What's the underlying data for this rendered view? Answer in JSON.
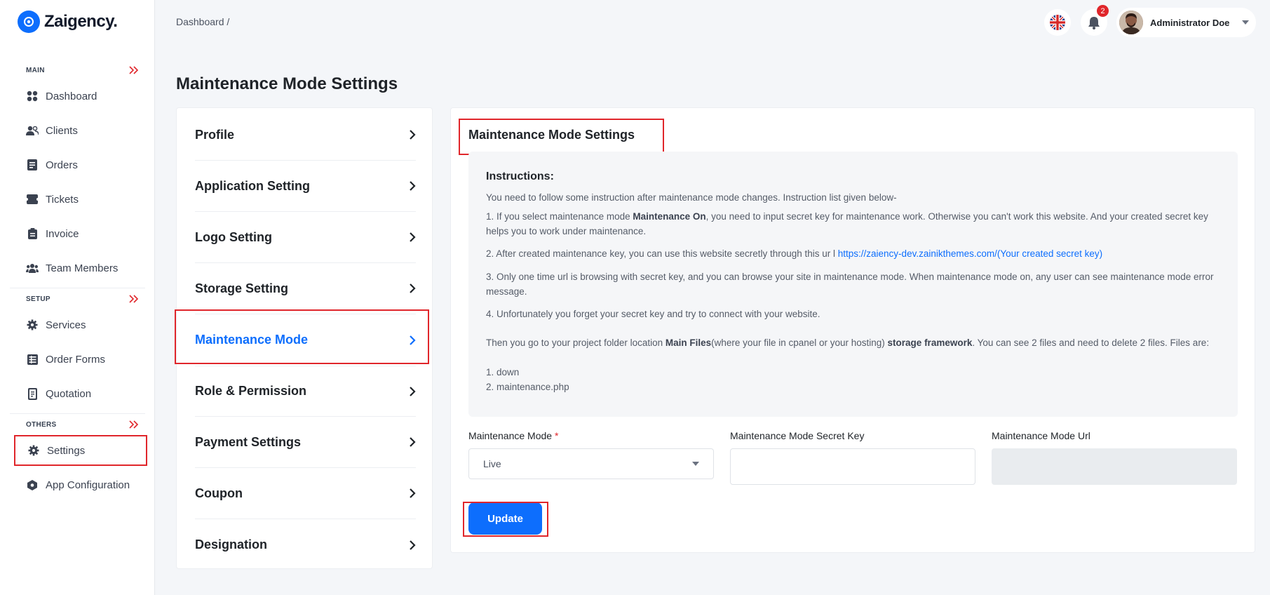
{
  "app": {
    "logo_text": "Zaigency."
  },
  "sidebar": {
    "sections": [
      {
        "label": "MAIN"
      },
      {
        "label": "SETUP"
      },
      {
        "label": "OTHERS"
      }
    ],
    "items": [
      {
        "label": "Dashboard",
        "icon": "grid-icon"
      },
      {
        "label": "Clients",
        "icon": "users-icon"
      },
      {
        "label": "Orders",
        "icon": "document-icon"
      },
      {
        "label": "Tickets",
        "icon": "ticket-icon"
      },
      {
        "label": "Invoice",
        "icon": "invoice-icon"
      },
      {
        "label": "Team Members",
        "icon": "team-icon"
      },
      {
        "label": "Services",
        "icon": "gear-icon"
      },
      {
        "label": "Order Forms",
        "icon": "form-icon"
      },
      {
        "label": "Quotation",
        "icon": "quotation-icon"
      },
      {
        "label": "Settings",
        "icon": "gear-icon",
        "active": true
      },
      {
        "label": "App Configuration",
        "icon": "config-icon"
      }
    ]
  },
  "topbar": {
    "breadcrumb": "Dashboard  /",
    "notifications_count": "2",
    "user_name": "Administrator Doe"
  },
  "page": {
    "title": "Maintenance Mode Settings"
  },
  "settings_menu": {
    "items": [
      {
        "label": "Profile"
      },
      {
        "label": "Application Setting"
      },
      {
        "label": "Logo Setting"
      },
      {
        "label": "Storage Setting"
      },
      {
        "label": "Maintenance Mode",
        "active": true
      },
      {
        "label": "Role & Permission"
      },
      {
        "label": "Payment Settings"
      },
      {
        "label": "Coupon"
      },
      {
        "label": "Designation"
      }
    ]
  },
  "content": {
    "title": "Maintenance Mode Settings",
    "instructions": {
      "heading": "Instructions:",
      "intro": "You need to follow some instruction after maintenance mode changes. Instruction list given below-",
      "step1_a": "1. If you select maintenance mode ",
      "step1_b": "Maintenance On",
      "step1_c": ", you need to input secret key for maintenance work. Otherwise you can't work this website. And your created secret key helps you to work under maintenance.",
      "step2_a": "2. After created maintenance key, you can use this website secretly through this ur l ",
      "step2_link": "https://zaiency-dev.zainikthemes.com/(Your created secret key)",
      "step3": "3. Only one time url is browsing with secret key, and you can browse your site in maintenance mode. When maintenance mode on, any user can see maintenance mode error message.",
      "step4": "4. Unfortunately you forget your secret key and try to connect with your website.",
      "then_a": "Then you go to your project folder location ",
      "then_b": "Main Files",
      "then_c": "(where your file in cpanel or your hosting) ",
      "then_d": "storage framework",
      "then_e": ". You can see 2 files and need to delete 2 files. Files are:",
      "file1": "1. down",
      "file2": "2. maintenance.php"
    },
    "form": {
      "mode_label": "Maintenance Mode",
      "mode_required": "*",
      "mode_value": "Live",
      "secret_label": "Maintenance Mode Secret Key",
      "secret_value": "",
      "url_label": "Maintenance Mode Url",
      "url_value": "",
      "update_label": "Update"
    }
  },
  "colors": {
    "accent": "#0d6efd",
    "highlight": "#e0262b",
    "badge": "#e0262b"
  }
}
